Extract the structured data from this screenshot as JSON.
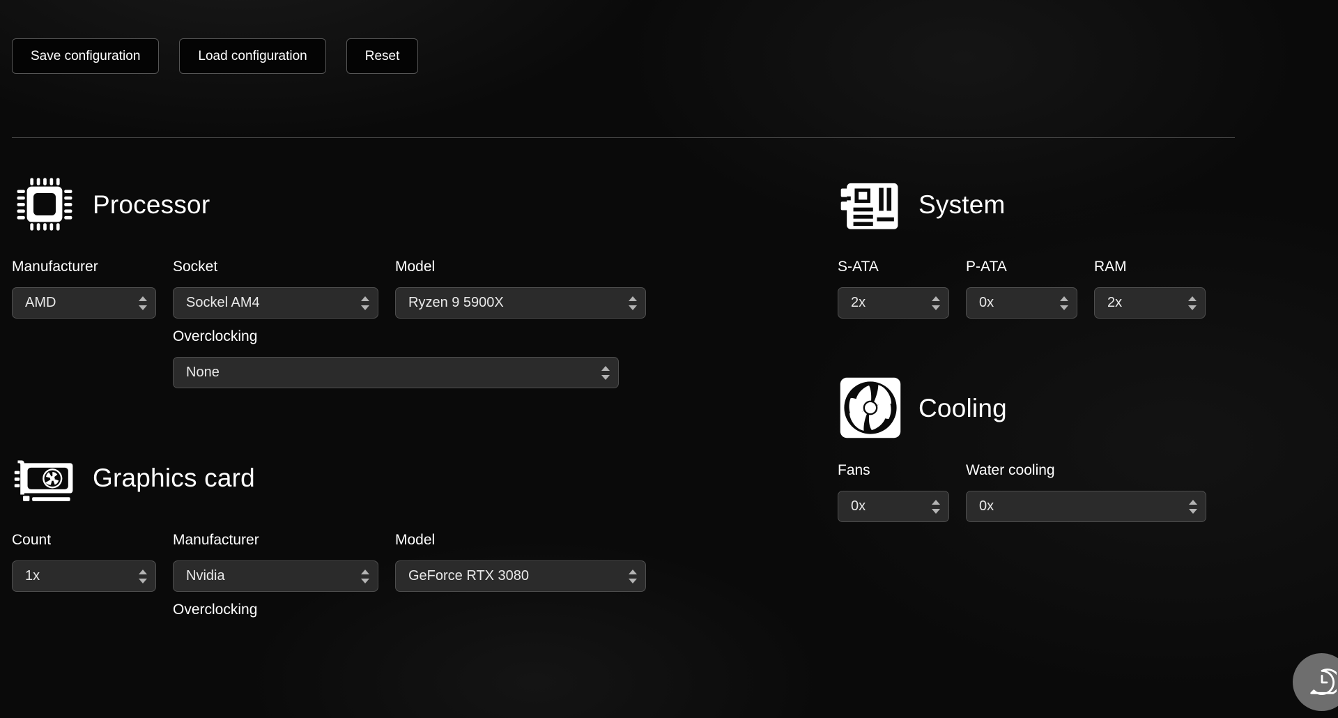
{
  "toolbar": {
    "save_label": "Save configuration",
    "load_label": "Load configuration",
    "reset_label": "Reset"
  },
  "sections": {
    "processor": {
      "title": "Processor",
      "icon": "cpu-chip-icon",
      "fields": {
        "manufacturer_label": "Manufacturer",
        "manufacturer_value": "AMD",
        "socket_label": "Socket",
        "socket_value": "Sockel AM4",
        "model_label": "Model",
        "model_value": "Ryzen 9 5900X",
        "overclocking_label": "Overclocking",
        "overclocking_value": "None"
      }
    },
    "system": {
      "title": "System",
      "icon": "motherboard-icon",
      "fields": {
        "sata_label": "S-ATA",
        "sata_value": "2x",
        "pata_label": "P-ATA",
        "pata_value": "0x",
        "ram_label": "RAM",
        "ram_value": "2x"
      }
    },
    "graphics": {
      "title": "Graphics card",
      "icon": "gpu-card-icon",
      "fields": {
        "count_label": "Count",
        "count_value": "1x",
        "manufacturer_label": "Manufacturer",
        "manufacturer_value": "Nvidia",
        "model_label": "Model",
        "model_value": "GeForce RTX 3080",
        "overclocking_label": "Overclocking"
      }
    },
    "cooling": {
      "title": "Cooling",
      "icon": "fan-icon",
      "fields": {
        "fans_label": "Fans",
        "fans_value": "0x",
        "water_label": "Water cooling",
        "water_value": "0x"
      }
    }
  },
  "widget": {
    "icon": "clock-chat-bubble-icon"
  },
  "colors": {
    "background": "#0a0a0a",
    "select_bg": "#2b2b2b",
    "select_border": "#4e4e4e",
    "button_border": "#565656",
    "text": "#ffffff",
    "divider": "#4a4a4a",
    "fab_bg": "#6e6e6e"
  }
}
